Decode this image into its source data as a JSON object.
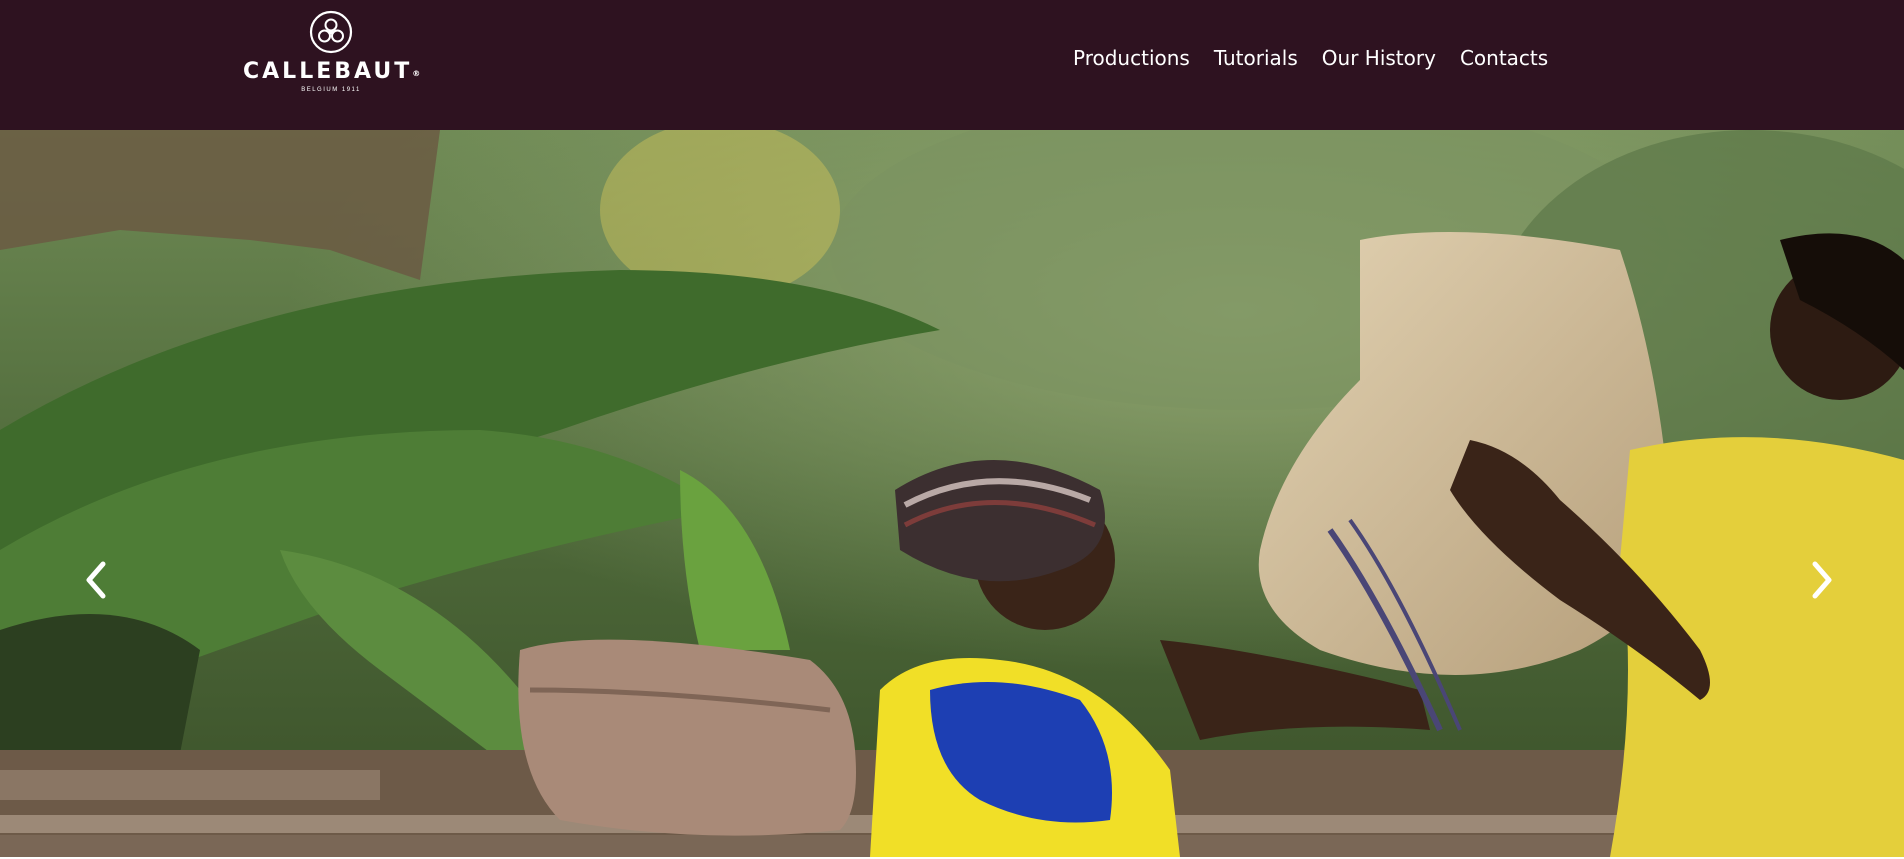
{
  "brand": {
    "name": "CALLEBAUT",
    "registered": "®",
    "tagline": "BELGIUM 1911"
  },
  "nav": {
    "items": [
      {
        "label": "Productions"
      },
      {
        "label": "Tutorials"
      },
      {
        "label": "Our History"
      },
      {
        "label": "Contacts"
      }
    ]
  },
  "carousel": {
    "prev_icon": "chevron-left-icon",
    "next_icon": "chevron-right-icon"
  },
  "colors": {
    "header_bg": "#2e1220",
    "nav_text": "#ffffff"
  }
}
